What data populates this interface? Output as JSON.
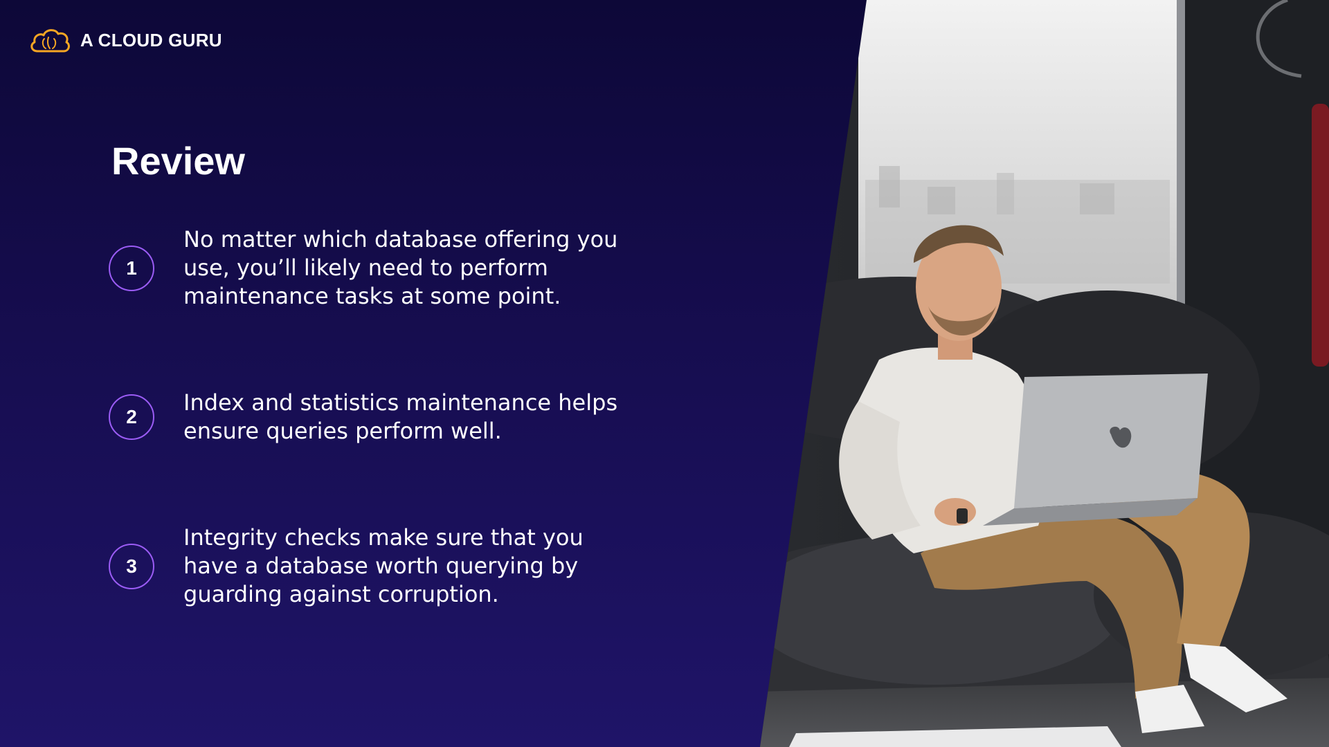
{
  "brand": {
    "name": "A CLOUD GURU",
    "icon": "cloud-brain-icon",
    "accent_color": "#f5a623"
  },
  "slide": {
    "title": "Review",
    "circle_color": "#9b5cf5",
    "items": [
      {
        "number": "1",
        "text": "No matter which database offering you use, you’ll likely need to perform maintenance tasks at some point."
      },
      {
        "number": "2",
        "text": "Index and statistics maintenance helps ensure queries perform well."
      },
      {
        "number": "3",
        "text": "Integrity checks make sure that you have a database worth querying by guarding against corruption."
      }
    ]
  },
  "photo": {
    "subject": "man-with-laptop-on-beanbag"
  }
}
